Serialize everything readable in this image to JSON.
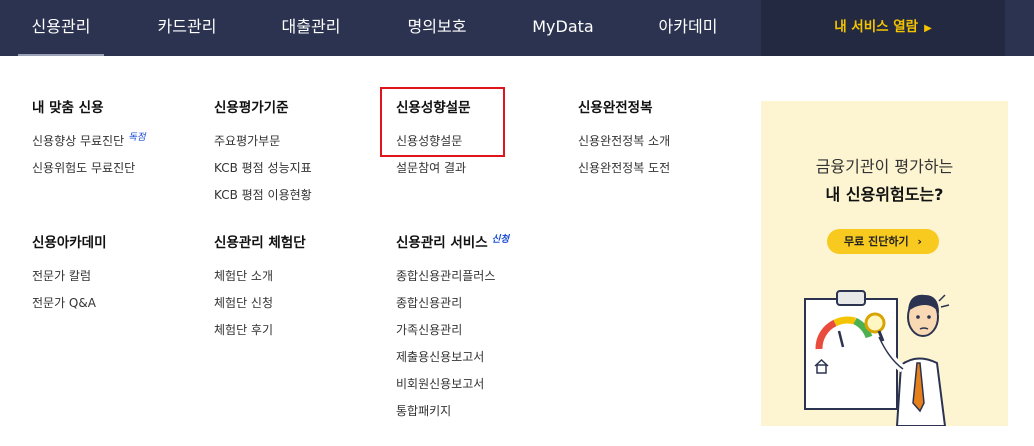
{
  "nav": {
    "items": [
      {
        "label": "신용관리"
      },
      {
        "label": "카드관리"
      },
      {
        "label": "대출관리"
      },
      {
        "label": "명의보호"
      },
      {
        "label": "MyData"
      },
      {
        "label": "아카데미"
      }
    ],
    "cta_label": "내 서비스 열람",
    "cta_icon": "triangle-right-icon"
  },
  "menu": {
    "my_credit": {
      "title": "내 맞춤 신용",
      "links": [
        {
          "label": "신용향상 무료진단",
          "tag": "독점"
        },
        {
          "label": "신용위험도 무료진단"
        }
      ]
    },
    "credit_criteria": {
      "title": "신용평가기준",
      "links": [
        {
          "label": "주요평가부문"
        },
        {
          "label": "KCB 평점 성능지표"
        },
        {
          "label": "KCB 평점 이용현황"
        }
      ]
    },
    "credit_survey": {
      "title": "신용성향설문",
      "links": [
        {
          "label": "신용성향설문"
        },
        {
          "label": "설문참여 결과"
        }
      ]
    },
    "credit_mastery": {
      "title": "신용완전정복",
      "links": [
        {
          "label": "신용완전정복 소개"
        },
        {
          "label": "신용완전정복 도전"
        }
      ]
    },
    "academy": {
      "title": "신용아카데미",
      "links": [
        {
          "label": "전문가 칼럼"
        },
        {
          "label": "전문가 Q&A"
        }
      ]
    },
    "experience": {
      "title": "신용관리 체험단",
      "links": [
        {
          "label": "체험단 소개"
        },
        {
          "label": "체험단 신청"
        },
        {
          "label": "체험단 후기"
        }
      ]
    },
    "services": {
      "title": "신용관리 서비스",
      "tag": "신청",
      "links": [
        {
          "label": "종합신용관리플러스"
        },
        {
          "label": "종합신용관리"
        },
        {
          "label": "가족신용관리"
        },
        {
          "label": "제출용신용보고서"
        },
        {
          "label": "비회원신용보고서"
        },
        {
          "label": "통합패키지"
        }
      ]
    }
  },
  "promo": {
    "line1": "금융기관이 평가하는",
    "line2": "내 신용위험도는?",
    "button_label": "무료 진단하기",
    "button_icon": "chevron-right-icon",
    "illustration": "man-with-magnifier-clipboard-gauge"
  },
  "colors": {
    "nav_bg": "#2c3350",
    "cta_bg": "#222940",
    "cta_text": "#f5c400",
    "highlight": "#e0141b",
    "promo_bg": "#fdf5d2",
    "promo_button": "#f8c91e",
    "tag_blue": "#1e4fd6"
  }
}
